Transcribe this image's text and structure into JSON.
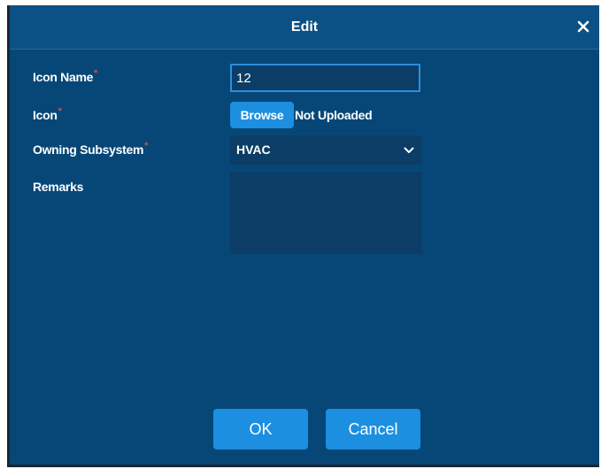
{
  "dialog": {
    "title": "Edit",
    "close_icon": "close-icon"
  },
  "form": {
    "icon_name": {
      "label": "Icon Name",
      "required_mark": "*",
      "value": "12"
    },
    "icon": {
      "label": "Icon",
      "required_mark": "*",
      "browse_label": "Browse",
      "status": "Not Uploaded"
    },
    "owning_subsystem": {
      "label": "Owning Subsystem",
      "required_mark": "*",
      "selected": "HVAC",
      "chevron_icon": "chevron-down-icon"
    },
    "remarks": {
      "label": "Remarks",
      "value": ""
    }
  },
  "actions": {
    "ok_label": "OK",
    "cancel_label": "Cancel"
  },
  "colors": {
    "dialog_bg": "#064777",
    "titlebar_bg": "#0b5185",
    "field_bg": "#0b3d66",
    "accent": "#1d8fe0",
    "required": "#e0474c",
    "text": "#ffffff"
  }
}
